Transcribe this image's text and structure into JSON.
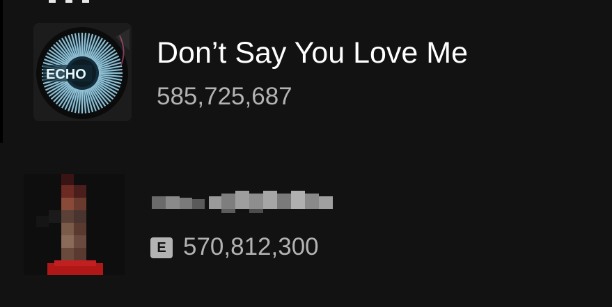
{
  "tracks": [
    {
      "title": "Don’t Say You Love Me",
      "plays": "585,725,687",
      "explicit": false,
      "cover_text": "ECHO"
    },
    {
      "title": "",
      "plays": "570,812,300",
      "explicit": true,
      "explicit_label": "E"
    }
  ],
  "colors": {
    "background": "#121212",
    "title": "#ffffff",
    "secondary": "#b3b3b3",
    "badge": "#b3b3b3"
  }
}
